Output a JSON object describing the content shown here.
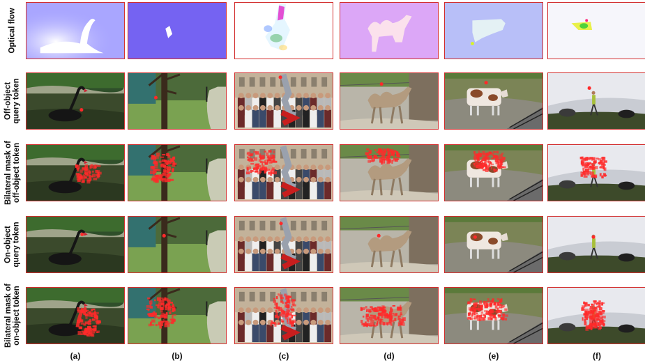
{
  "row_labels": [
    [
      "Optical flow"
    ],
    [
      "Off-object",
      "query token"
    ],
    [
      "Bilateral mask of",
      "off-object token"
    ],
    [
      "On-object",
      "query token"
    ],
    [
      "Bilateral mask of",
      "on-object token"
    ]
  ],
  "column_labels": [
    "(a)",
    "(b)",
    "(c)",
    "(d)",
    "(e)",
    "(f)"
  ],
  "scene_names": [
    "swan",
    "park",
    "crowd",
    "camel",
    "cow",
    "dog"
  ],
  "row_types": [
    "flow",
    "query-off",
    "mask-off",
    "query-on",
    "mask-on"
  ],
  "colors": {
    "frame_border": "#d32f2f",
    "mask_red": "#ff2a2a",
    "flow_bg": [
      "#a9a6ff",
      "#7563f2",
      "#ffffff",
      "#dca7f7",
      "#b8bff8",
      "#f6f6fb"
    ]
  }
}
